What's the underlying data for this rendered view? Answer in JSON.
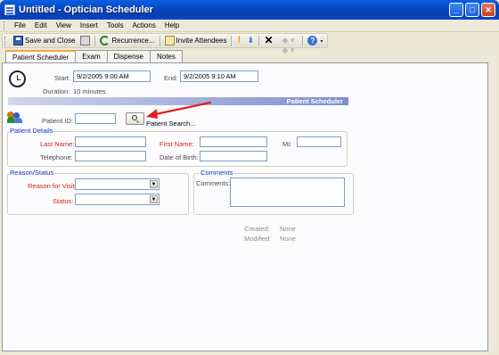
{
  "window": {
    "title": "Untitled - Optician Scheduler"
  },
  "menu": [
    "File",
    "Edit",
    "View",
    "Insert",
    "Tools",
    "Actions",
    "Help"
  ],
  "toolbar": {
    "save_close": "Save and Close",
    "recurrence": "Recurrence...",
    "invite": "Invite Attendees"
  },
  "tabs": [
    "Patient Scheduler",
    "Exam",
    "Dispense",
    "Notes"
  ],
  "schedule": {
    "start_label": "Start:",
    "start_value": "9/2/2005 9:00 AM",
    "end_label": "End:",
    "end_value": "9/2/2005 9:10 AM",
    "duration_label": "Duration:",
    "duration_value": "10 minutes"
  },
  "section_title": "Patient Scheduler",
  "patient": {
    "id_label": "Patient ID:",
    "search_label": "Patient Search..."
  },
  "details": {
    "title": "Patient Details",
    "last_name": "Last Name:",
    "first_name": "First Name:",
    "mi": "MI:",
    "telephone": "Telephone:",
    "dob": "Date of Birth:"
  },
  "reason": {
    "title": "Reason/Status",
    "reason_label": "Reason for Visit:",
    "status_label": "Status:"
  },
  "comments": {
    "title": "Comments",
    "label": "Comments:"
  },
  "meta": {
    "created_label": "Created:",
    "created_value": "None",
    "modified_label": "Modified:",
    "modified_value": "None"
  },
  "colors": {
    "title_bar": "#0A4FD0",
    "required_label": "#D02020",
    "group_title": "#1030C8",
    "annotation_arrow": "#E02020"
  }
}
